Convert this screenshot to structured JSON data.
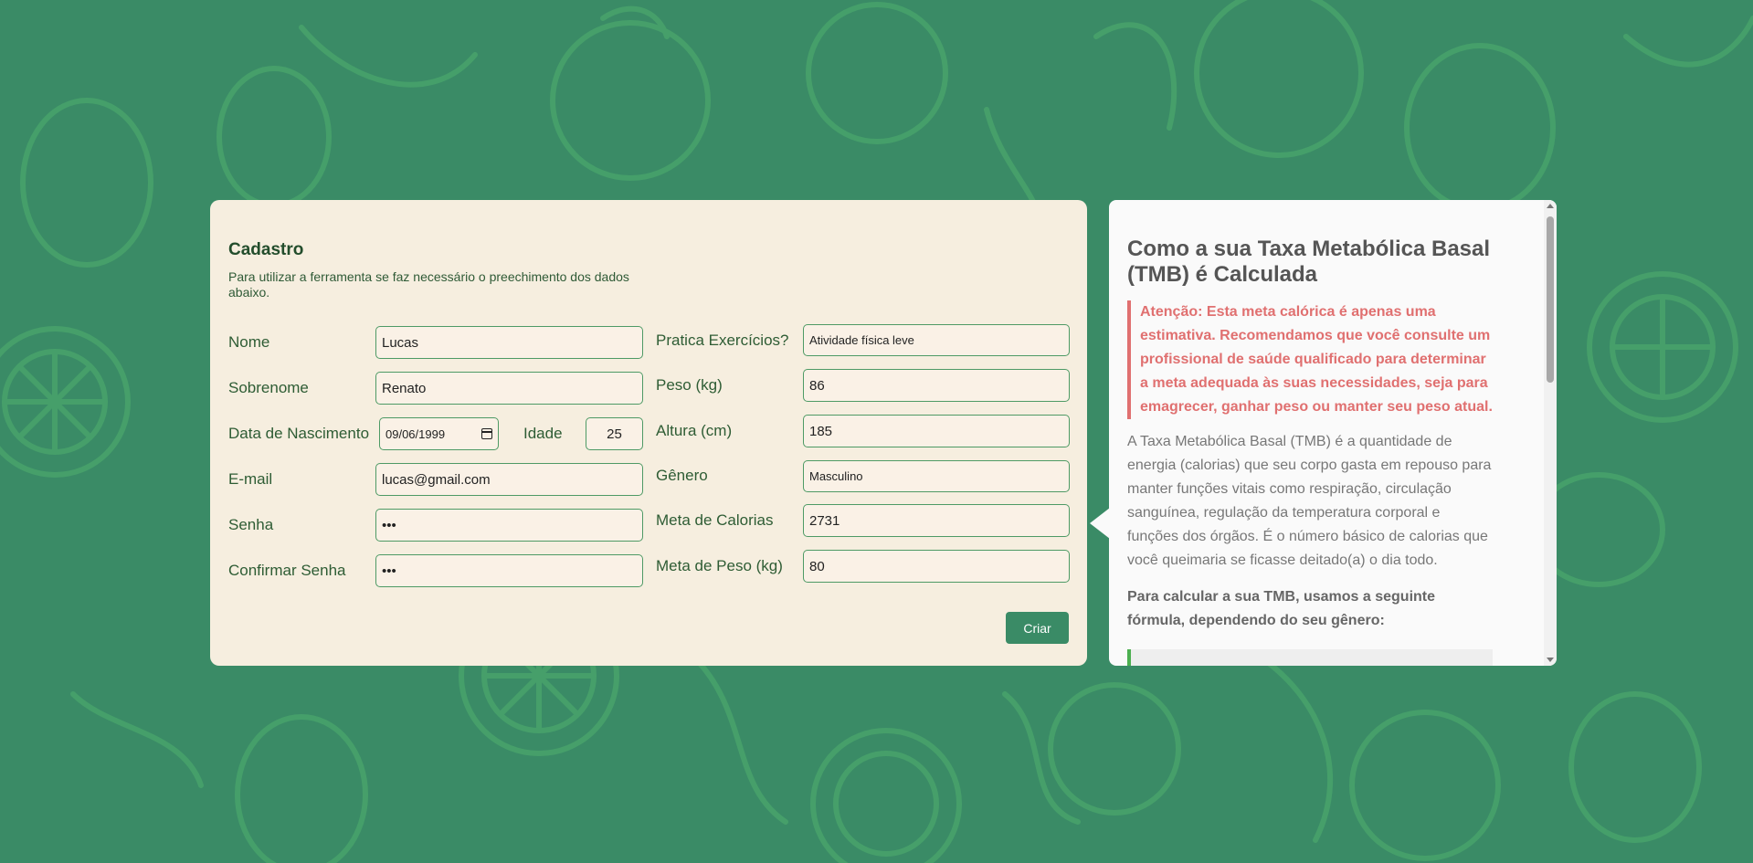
{
  "colors": {
    "background": "#3a8b66",
    "card": "#f6eedf",
    "accent": "#3a8b66",
    "warning": "#e07070"
  },
  "form": {
    "title": "Cadastro",
    "subtitle": "Para utilizar a ferramenta se faz necessário o preechimento dos dados abaixo.",
    "left": {
      "nome_label": "Nome",
      "nome_value": "Lucas",
      "sobrenome_label": "Sobrenome",
      "sobrenome_value": "Renato",
      "nascimento_label": "Data de Nascimento",
      "nascimento_value": "09/06/1999",
      "idade_label": "Idade",
      "idade_value": "25",
      "email_label": "E-mail",
      "email_value": "lucas@gmail.com",
      "senha_label": "Senha",
      "senha_value": "•••",
      "confirmar_label": "Confirmar Senha",
      "confirmar_value": "•••"
    },
    "right": {
      "exercicios_label": "Pratica Exercícios?",
      "exercicios_value": "Atividade física leve",
      "peso_label": "Peso (kg)",
      "peso_value": "86",
      "altura_label": "Altura (cm)",
      "altura_value": "185",
      "genero_label": "Gênero",
      "genero_value": "Masculino",
      "calorias_label": "Meta de Calorias",
      "calorias_value": "2731",
      "meta_peso_label": "Meta de Peso (kg)",
      "meta_peso_value": "80"
    },
    "submit_label": "Criar"
  },
  "info": {
    "title": "Como a sua Taxa Metabólica Basal (TMB) é Calculada",
    "warning": "Atenção: Esta meta calórica é apenas uma estimativa. Recomendamos que você consulte um profissional de saúde qualificado para determinar a meta adequada às suas necessidades, seja para emagrecer, ganhar peso ou manter seu peso atual.",
    "paragraph": "A Taxa Metabólica Basal (TMB) é a quantidade de energia (calorias) que seu corpo gasta em repouso para manter funções vitais como respiração, circulação sanguínea, regulação da temperatura corporal e funções dos órgãos. É o número básico de calorias que você queimaria se ficasse deitado(a) o dia todo.",
    "formula_intro": "Para calcular a sua TMB, usamos a seguinte fórmula, dependendo do seu gênero:"
  }
}
